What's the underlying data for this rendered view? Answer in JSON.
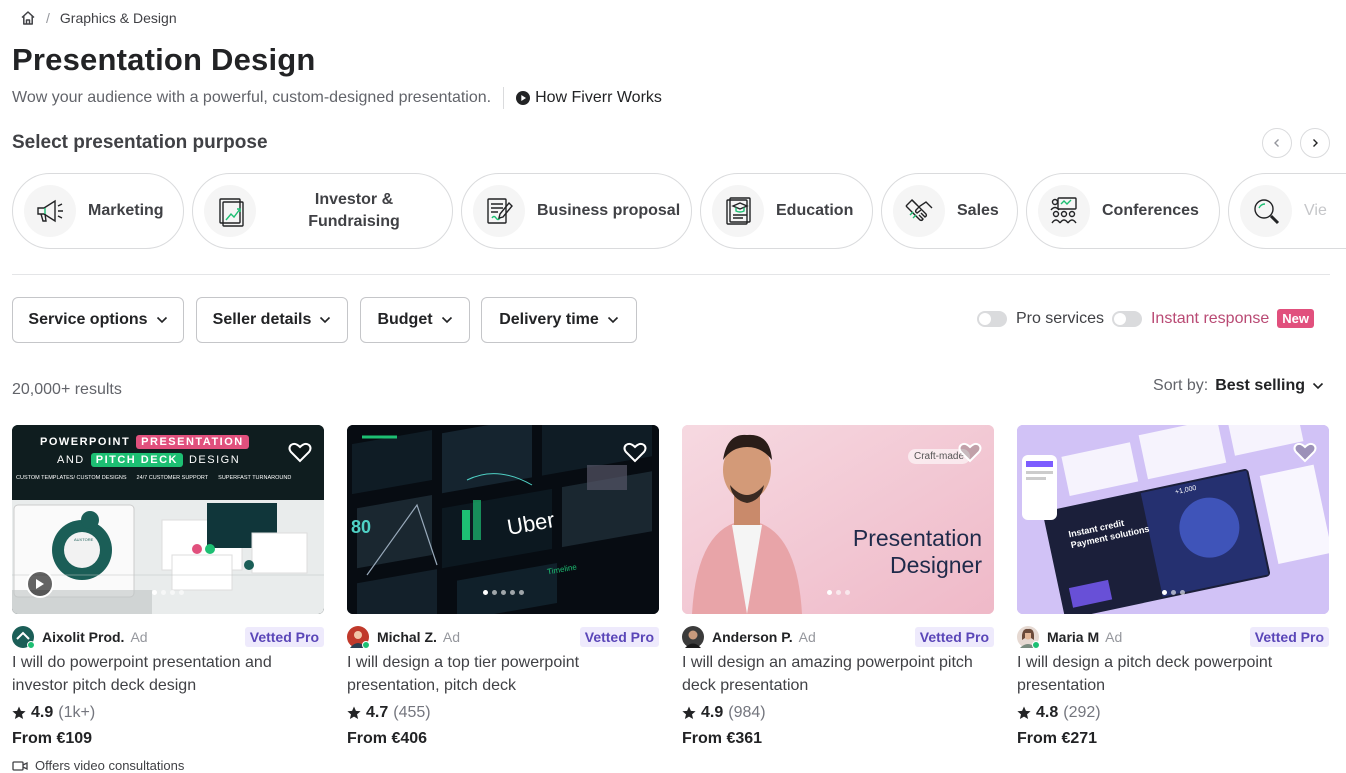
{
  "breadcrumb": {
    "category": "Graphics & Design"
  },
  "header": {
    "title": "Presentation Design",
    "subtitle": "Wow your audience with a powerful, custom-designed presentation.",
    "how_works": "How Fiverr Works"
  },
  "purposes": {
    "title": "Select presentation purpose",
    "items": [
      {
        "label": "Marketing",
        "icon": "megaphone-icon"
      },
      {
        "label": "Investor &\nFundraising",
        "icon": "growth-chart-icon"
      },
      {
        "label": "Business proposal",
        "icon": "document-pen-icon"
      },
      {
        "label": "Education",
        "icon": "graduation-doc-icon"
      },
      {
        "label": "Sales",
        "icon": "handshake-icon"
      },
      {
        "label": "Conferences",
        "icon": "audience-icon"
      },
      {
        "label": "Vie",
        "icon": "magnifier-icon"
      }
    ]
  },
  "filters": {
    "service_options": "Service options",
    "seller_details": "Seller details",
    "budget": "Budget",
    "delivery_time": "Delivery time",
    "pro_services": "Pro services",
    "instant_response": "Instant response",
    "new_badge": "New"
  },
  "results": {
    "count": "20,000+ results",
    "sort_label": "Sort by:",
    "sort_value": "Best selling"
  },
  "gigs": [
    {
      "seller": "Aixolit Prod.",
      "ad": "Ad",
      "badge": "Vetted Pro",
      "title": "I will do powerpoint presentation and investor pitch deck design",
      "rating": "4.9",
      "reviews": "(1k+)",
      "price": "From €109",
      "extra": "Offers video consultations",
      "thumb": {
        "line1a": "POWERPOINT",
        "line1b": "PRESENTATION",
        "line2a": "AND",
        "line2b": "PITCH DECK",
        "line2c": "DESIGN",
        "features": [
          "CUSTOM TEMPLATES/ CUSTOM DESIGNS",
          "24/7 CUSTOMER SUPPORT",
          "SUPERFAST TURNAROUND"
        ],
        "brand": "AUXTORE"
      }
    },
    {
      "seller": "Michal Z.",
      "ad": "Ad",
      "badge": "Vetted Pro",
      "title": "I will design a top tier powerpoint presentation, pitch deck",
      "rating": "4.7",
      "reviews": "(455)",
      "price": "From €406",
      "thumb": {
        "brand": "Uber",
        "big_number": "80",
        "label": "Timeline"
      }
    },
    {
      "seller": "Anderson P.",
      "ad": "Ad",
      "badge": "Vetted Pro",
      "title": "I will design an amazing powerpoint pitch deck presentation",
      "rating": "4.9",
      "reviews": "(984)",
      "price": "From €361",
      "thumb": {
        "tag": "Craft-made",
        "line1": "Presentation",
        "line2": "Designer"
      }
    },
    {
      "seller": "Maria M",
      "ad": "Ad",
      "badge": "Vetted Pro",
      "title": "I will design a pitch deck powerpoint presentation",
      "rating": "4.8",
      "reviews": "(292)",
      "price": "From €271",
      "thumb": {
        "headline": "Instant credit Payment solutions",
        "stat": "+1,000"
      }
    }
  ],
  "colors": {
    "accent_green": "#1dbf73",
    "vetted_bg": "#eeeafc",
    "vetted_text": "#5a46b8",
    "instant_text": "#b94a74",
    "new_badge_bg": "#e1507d"
  }
}
